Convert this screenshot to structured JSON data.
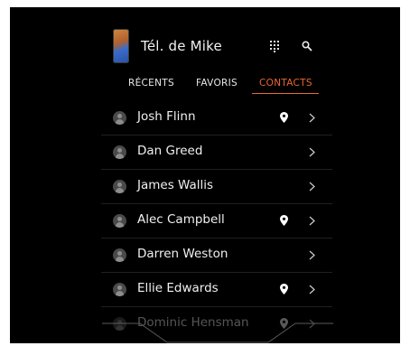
{
  "header": {
    "title": "Tél. de Mike",
    "phone_icon": "phone-thumbnail-icon",
    "keypad_icon": "dialpad-icon",
    "search_icon": "search-icon"
  },
  "tabs": [
    {
      "label": "RÉCENTS",
      "active": false
    },
    {
      "label": "FAVORIS",
      "active": false
    },
    {
      "label": "CONTACTS",
      "active": true
    }
  ],
  "contacts": [
    {
      "name": "Josh Flinn",
      "location": true
    },
    {
      "name": "Dan Greed",
      "location": false
    },
    {
      "name": "James Wallis",
      "location": false
    },
    {
      "name": "Alec Campbell",
      "location": true
    },
    {
      "name": "Darren Weston",
      "location": false
    },
    {
      "name": "Ellie Edwards",
      "location": true
    },
    {
      "name": "Dominic Hensman",
      "location": true
    }
  ],
  "colors": {
    "background": "#000000",
    "accent": "#e9672f",
    "text": "#f0f0f0",
    "divider": "#202020"
  }
}
